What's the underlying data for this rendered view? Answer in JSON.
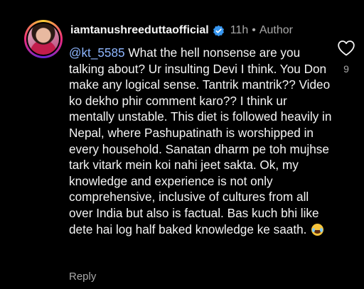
{
  "comment": {
    "username": "iamtanushreeduttaofficial",
    "time": "11h",
    "separator": "•",
    "author_label": "Author",
    "mention": "@kt_5585",
    "body": " What the hell nonsense are you talking about? Ur insulting Devi I think. You Don make any logical sense. Tantrik mantrik?? Video ko dekho phir comment karo?? I think ur mentally unstable. This diet is followed heavily in Nepal, where Pashupatinath is worshipped in every household. Sanatan dharm pe toh mujhse tark vitark mein koi nahi jeet sakta. Ok, my knowledge and experience is not only comprehensive, inclusive of cultures from all over India but also is factual. Bas kuch bhi like dete hai log half baked knowledge ke saath. ",
    "emoji": "face-with-tears-of-joy",
    "reply_label": "Reply",
    "like_count": "9"
  },
  "icons": {
    "verified": "verified-badge-icon",
    "like": "heart-outline-icon"
  },
  "colors": {
    "background": "#000000",
    "text": "#f5f5f5",
    "secondary": "#a8a8a8",
    "mention": "#8fb7ff",
    "verified": "#3897f0"
  }
}
